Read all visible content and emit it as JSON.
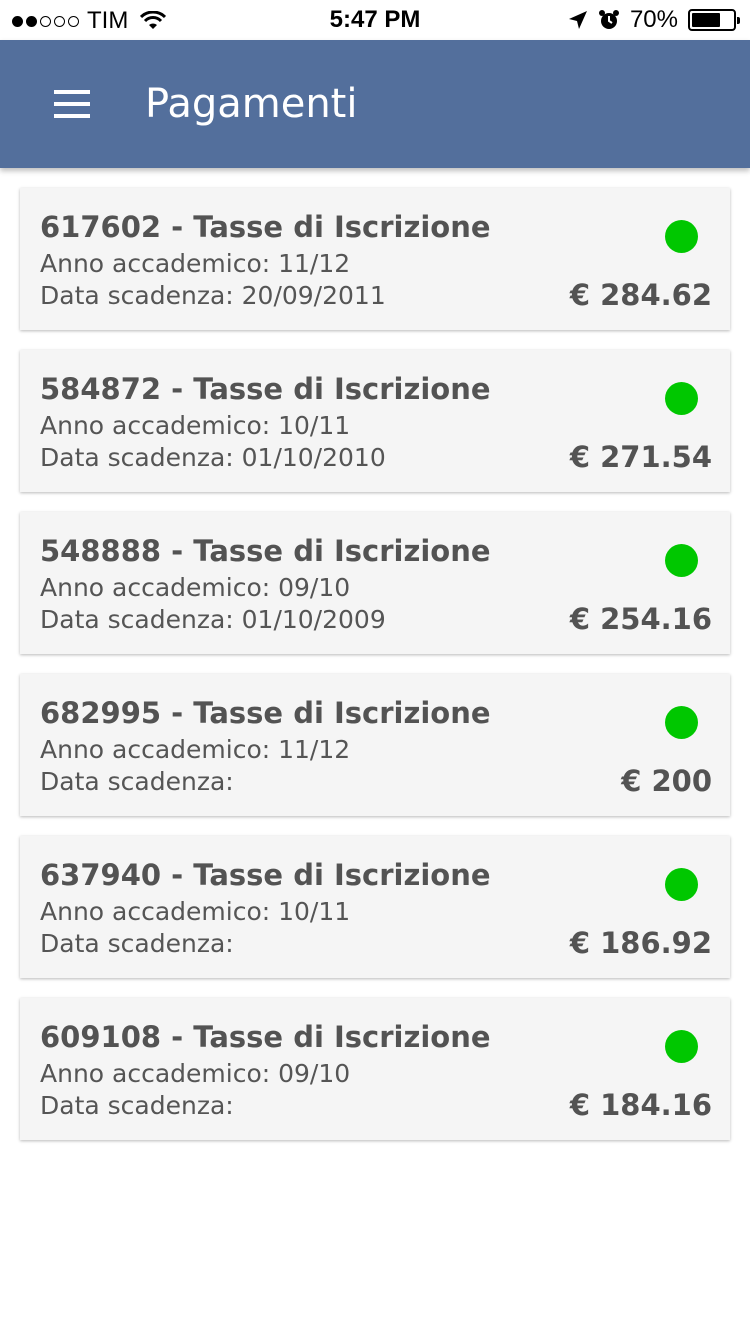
{
  "status_bar": {
    "carrier": "TIM",
    "time": "5:47 PM",
    "battery": "70%",
    "battery_level": 0.7
  },
  "header": {
    "title": "Pagamenti",
    "menu_icon": "hamburger-menu-icon"
  },
  "colors": {
    "appbar": "#536f9c",
    "status_ok": "#00c700"
  },
  "payments": [
    {
      "title": "617602 - Tasse di Iscrizione",
      "year": "Anno accademico: 11/12",
      "due": "Data scadenza: 20/09/2011",
      "amount": "€ 284.62"
    },
    {
      "title": "584872 - Tasse di Iscrizione",
      "year": "Anno accademico: 10/11",
      "due": "Data scadenza: 01/10/2010",
      "amount": "€ 271.54"
    },
    {
      "title": "548888 - Tasse di Iscrizione",
      "year": "Anno accademico: 09/10",
      "due": "Data scadenza: 01/10/2009",
      "amount": "€ 254.16"
    },
    {
      "title": "682995 - Tasse di Iscrizione",
      "year": "Anno accademico: 11/12",
      "due": "Data scadenza:",
      "amount": "€ 200"
    },
    {
      "title": "637940 - Tasse di Iscrizione",
      "year": "Anno accademico: 10/11",
      "due": "Data scadenza:",
      "amount": "€ 186.92"
    },
    {
      "title": "609108 - Tasse di Iscrizione",
      "year": "Anno accademico: 09/10",
      "due": "Data scadenza:",
      "amount": "€ 184.16"
    }
  ]
}
